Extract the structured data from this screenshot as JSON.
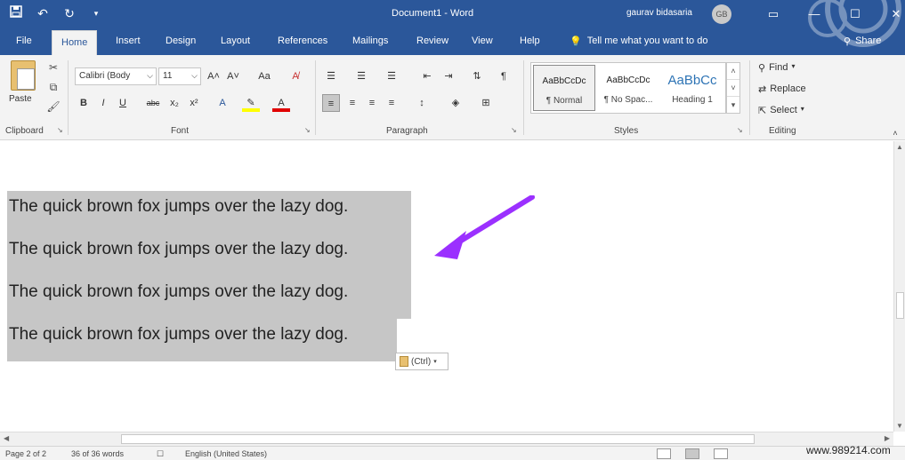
{
  "window": {
    "title": "Document1 - Word",
    "user": "gaurav bidasaria",
    "avatar_initials": "GB"
  },
  "qat": {
    "save_icon": "save-icon",
    "undo_icon": "undo-icon",
    "redo_icon": "redo-icon",
    "customize_icon": "customize-icon"
  },
  "tabs": [
    "File",
    "Home",
    "Insert",
    "Design",
    "Layout",
    "References",
    "Mailings",
    "Review",
    "View",
    "Help"
  ],
  "tell_me": "Tell me what you want to do",
  "share": "Share",
  "ribbon": {
    "clipboard": {
      "paste": "Paste",
      "label": "Clipboard"
    },
    "font": {
      "font_name": "Calibri (Body",
      "font_size": "11",
      "label": "Font",
      "grow": "A˄",
      "shrink": "A˅",
      "case": "Aa",
      "bold": "B",
      "italic": "I",
      "underline": "U",
      "strike": "abc",
      "subscript": "x₂",
      "superscript": "x²"
    },
    "paragraph": {
      "label": "Paragraph",
      "pilcrow": "¶"
    },
    "styles": {
      "label": "Styles",
      "items": [
        {
          "sample": "AaBbCcDc",
          "name": "¶ Normal"
        },
        {
          "sample": "AaBbCcDc",
          "name": "¶ No Spac..."
        },
        {
          "sample": "AaBbCc",
          "name": "Heading 1"
        }
      ]
    },
    "editing": {
      "label": "Editing",
      "find": "Find",
      "replace": "Replace",
      "select": "Select"
    }
  },
  "document": {
    "lines": [
      "The quick brown fox jumps over the lazy dog.",
      "The quick brown fox jumps over the lazy dog.",
      "The quick brown fox jumps over the lazy dog.",
      "The quick brown fox jumps over the lazy dog."
    ],
    "paste_options": "(Ctrl)",
    "arrow_color": "#9b30ff",
    "selection_color": "#c6c6c6"
  },
  "status": {
    "page": "Page 2 of 2",
    "words": "36 of 36 words",
    "language": "English (United States)"
  },
  "watermark": "www.989214.com",
  "colors": {
    "title_bar": "#2b579a",
    "ribbon": "#f3f3f3",
    "heading": "#2e74b5"
  }
}
